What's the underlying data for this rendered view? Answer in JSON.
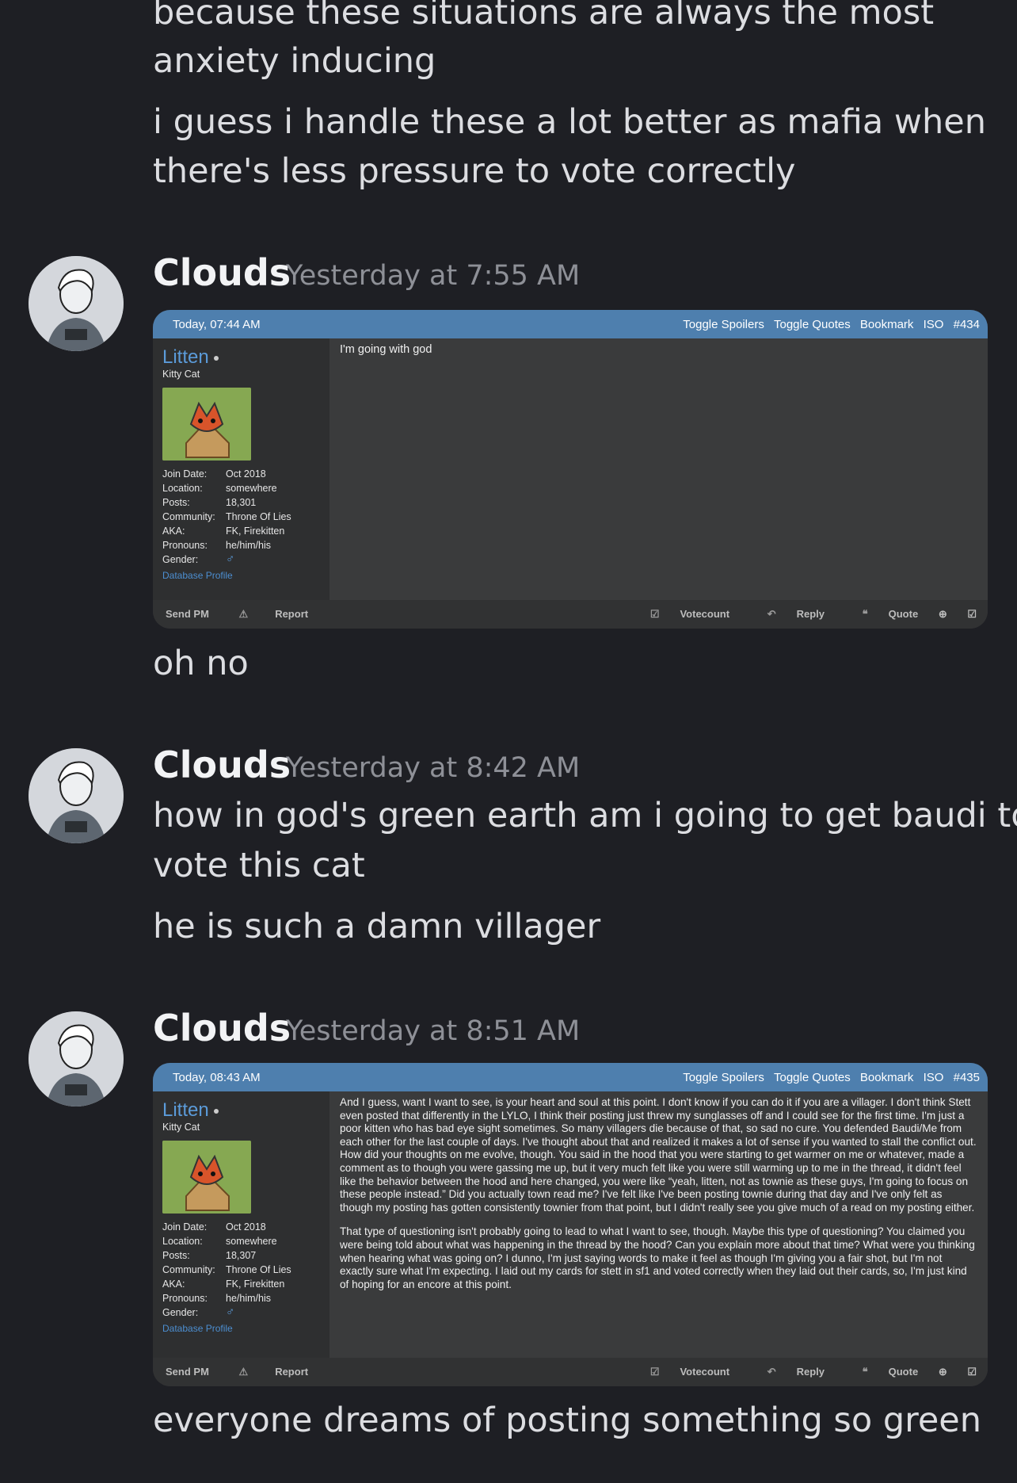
{
  "messages": [
    {
      "lines": [
        "because these situations are always the most",
        "anxiety inducing",
        "i guess i handle these a lot better as mafia when",
        "there's less pressure to vote correctly"
      ]
    },
    {
      "author": "Clouds",
      "timestamp": "Yesterday at 7:55 AM",
      "embed": {
        "date": "Today, 07:44 AM",
        "links": [
          "Toggle Spoilers",
          "Toggle Quotes",
          "Bookmark",
          "ISO",
          "#434"
        ],
        "user": {
          "name": "Litten",
          "title": "Kitty Cat",
          "fields": [
            {
              "k": "Join Date:",
              "v": "Oct 2018"
            },
            {
              "k": "Location:",
              "v": "somewhere"
            },
            {
              "k": "Posts:",
              "v": "18,301"
            },
            {
              "k": "Community:",
              "v": "Throne Of Lies"
            },
            {
              "k": "AKA:",
              "v": "FK, Firekitten"
            },
            {
              "k": "Pronouns:",
              "v": "he/him/his"
            },
            {
              "k": "Gender:",
              "v": "♂"
            }
          ],
          "db": "Database Profile"
        },
        "post": [
          "I'm going with god"
        ],
        "footer_left": [
          "Send PM",
          "Report"
        ],
        "footer_right": [
          "Votecount",
          "Reply",
          "Quote"
        ]
      },
      "after": "oh no"
    },
    {
      "author": "Clouds",
      "timestamp": "Yesterday at 8:42 AM",
      "lines": [
        "how in god's green earth am i going to get baudi to",
        "vote this cat",
        "he is such a damn villager"
      ]
    },
    {
      "author": "Clouds",
      "timestamp": "Yesterday at 8:51 AM",
      "embed": {
        "date": "Today, 08:43 AM",
        "links": [
          "Toggle Spoilers",
          "Toggle Quotes",
          "Bookmark",
          "ISO",
          "#435"
        ],
        "user": {
          "name": "Litten",
          "title": "Kitty Cat",
          "fields": [
            {
              "k": "Join Date:",
              "v": "Oct 2018"
            },
            {
              "k": "Location:",
              "v": "somewhere"
            },
            {
              "k": "Posts:",
              "v": "18,307"
            },
            {
              "k": "Community:",
              "v": "Throne Of Lies"
            },
            {
              "k": "AKA:",
              "v": "FK, Firekitten"
            },
            {
              "k": "Pronouns:",
              "v": "he/him/his"
            },
            {
              "k": "Gender:",
              "v": "♂"
            }
          ],
          "db": "Database Profile"
        },
        "post": [
          "And I guess, want I want to see, is your heart and soul at this point. I don't know if you can do it if you are a villager. I don't think Stett even posted that differently in the LYLO, I think their posting just threw my sunglasses off and I could see for the first time. I'm just a poor kitten who has bad eye sight sometimes. So many villagers die because of that, so sad no cure. You defended Baudi/Me from each other for the last couple of days. I've thought about that and realized it makes a lot of sense if you wanted to stall the conflict out. How did your thoughts on me evolve, though. You said in the hood that you were starting to get warmer on me or whatever, made a comment as to though you were gassing me up, but it very much felt like you were still warming up to me in the thread, it didn't feel like the behavior between the hood and here changed, you were like “yeah, litten, not as townie as these guys, I'm going to focus on these people instead.” Did you actually town read me? I've felt like I've been posting townie during that day and I've only felt as though my posting has gotten consistently townier from that point, but I didn't really see you give much of a read on my posting either.",
          "That type of questioning isn't probably going to lead to what I want to see, though. Maybe this type of questioning? You claimed you were being told about what was happening in the thread by the hood? Can you explain more about that time? What were you thinking when hearing what was going on? I dunno, I'm just saying words to make it feel as though I'm giving you a fair shot, but I'm not exactly sure what I'm expecting. I laid out my cards for stett in sf1 and voted correctly when they laid out their cards, so, I'm just kind of hoping for an encore at this point."
        ],
        "footer_left": [
          "Send PM",
          "Report"
        ],
        "footer_right": [
          "Votecount",
          "Reply",
          "Quote"
        ]
      },
      "after": "everyone dreams of posting something so green"
    }
  ]
}
